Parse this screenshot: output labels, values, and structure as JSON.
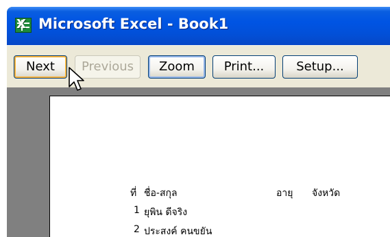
{
  "window": {
    "title": "Microsoft Excel - Book1",
    "app_icon": "excel-icon",
    "app_icon_glyph": "X"
  },
  "toolbar": {
    "next_label": "Next",
    "previous_label": "Previous",
    "zoom_label": "Zoom",
    "print_label": "Print...",
    "setup_label": "Setup..."
  },
  "sheet": {
    "headers": [
      "ที่",
      "ชื่อ-สกุล",
      "อายุ",
      "จังหวัด"
    ],
    "rows": [
      {
        "no": "1",
        "name": "ยุพิน ดีจริง"
      },
      {
        "no": "2",
        "name": "ประสงค์ คนขยัน"
      }
    ]
  },
  "colors": {
    "titlebar": "#0054e3",
    "toolbar": "#ece9d8",
    "preview_bg": "#808080",
    "hot_border": "#f8b33c",
    "focus_border": "#98b8ea",
    "disabled_text": "#aca899"
  },
  "icons": {
    "cursor": "mouse-pointer-icon"
  }
}
